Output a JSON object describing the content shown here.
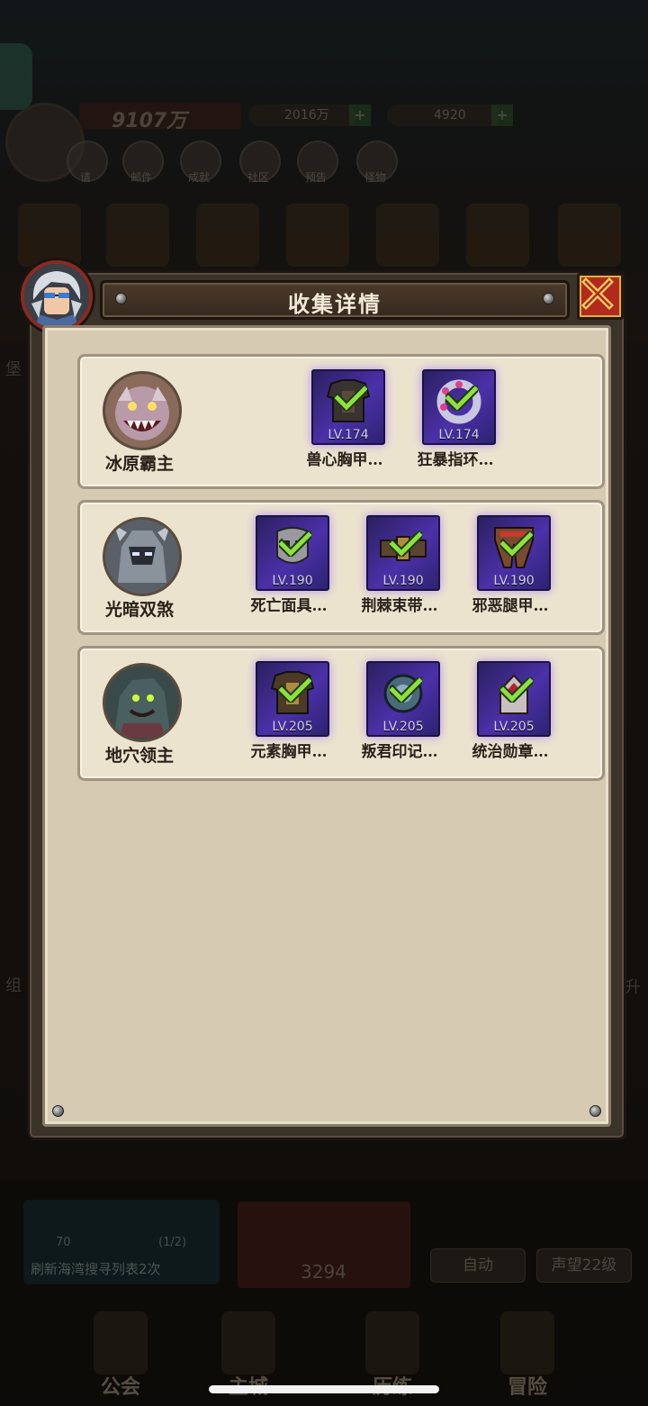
{
  "background": {
    "power_value": "9107万",
    "diamonds": "2016万",
    "gold": "4920",
    "menu_labels": [
      "请",
      "邮件",
      "成就",
      "社区",
      "预告",
      "怪物"
    ],
    "side_left": "组",
    "side_right": "升",
    "side_castle": "堡",
    "task": {
      "count": "70",
      "progress": "(1/2)",
      "text": "刷新海湾搜寻列表2次"
    },
    "loot_value": "3294",
    "auto_label": "自动",
    "reputation_label": "声望22级",
    "nav": [
      "公会",
      "主城",
      "历练",
      "冒险"
    ]
  },
  "dialog": {
    "title": "收集详情",
    "bosses": [
      {
        "name": "冰原霸主",
        "portrait_icon": "ice-boss-portrait",
        "items": [
          {
            "name": "兽心胸甲…",
            "level": "LV.174",
            "icon": "chest-armor-icon",
            "collected": true
          },
          {
            "name": "狂暴指环…",
            "level": "LV.174",
            "icon": "ring-icon",
            "collected": true
          }
        ]
      },
      {
        "name": "光暗双煞",
        "portrait_icon": "dark-light-boss-portrait",
        "items": [
          {
            "name": "死亡面具…",
            "level": "LV.190",
            "icon": "mask-icon",
            "collected": true
          },
          {
            "name": "荆棘束带…",
            "level": "LV.190",
            "icon": "belt-icon",
            "collected": true
          },
          {
            "name": "邪恶腿甲…",
            "level": "LV.190",
            "icon": "leg-armor-icon",
            "collected": true
          }
        ]
      },
      {
        "name": "地穴领主",
        "portrait_icon": "crypt-boss-portrait",
        "items": [
          {
            "name": "元素胸甲…",
            "level": "LV.205",
            "icon": "chest-armor-icon",
            "collected": true
          },
          {
            "name": "叛君印记…",
            "level": "LV.205",
            "icon": "seal-icon",
            "collected": true
          },
          {
            "name": "统治勋章…",
            "level": "LV.205",
            "icon": "medal-icon",
            "collected": true
          }
        ]
      }
    ]
  }
}
